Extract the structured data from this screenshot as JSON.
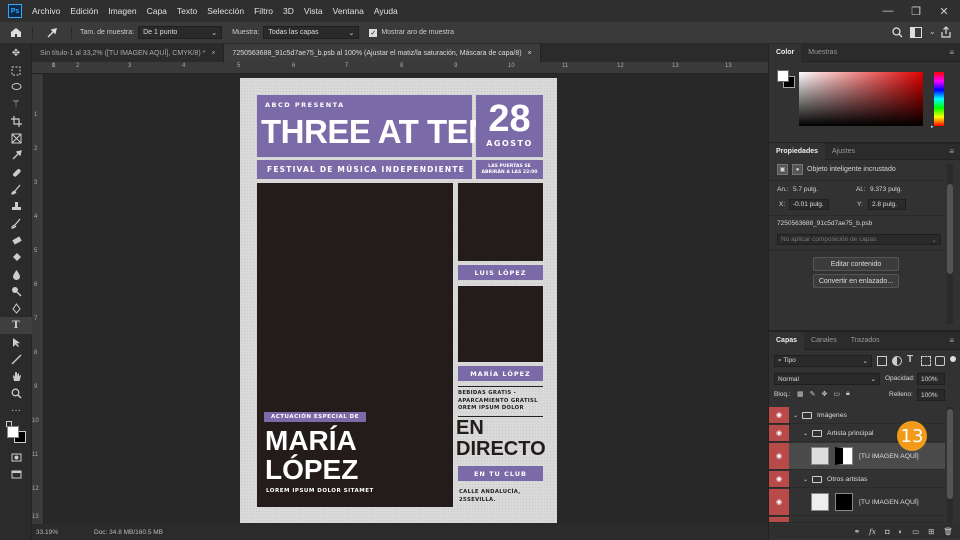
{
  "app": {
    "logo": "Ps",
    "menu": [
      "Archivo",
      "Edición",
      "Imagen",
      "Capa",
      "Texto",
      "Selección",
      "Filtro",
      "3D",
      "Vista",
      "Ventana",
      "Ayuda"
    ],
    "window_buttons": [
      "—",
      "❐",
      "✕"
    ]
  },
  "options": {
    "sample_size_label": "Tam. de muestra:",
    "sample_size_value": "De 1 punto",
    "sample_label": "Muestra:",
    "sample_value": "Todas las capas",
    "show_ring_label": "Mostrar aro de muestra"
  },
  "tabs": [
    {
      "label": "Sin título-1 al 33,2% ([TU IMAGEN AQUÍ], CMYK/8) *",
      "close": "×"
    },
    {
      "label": "7250563688_91c5d7ae75_b.psb al 100% (Ajustar el matiz/la saturación, Máscara de capa/8)",
      "close": "×"
    }
  ],
  "ruler": {
    "h": [
      "0",
      "1",
      "2",
      "3",
      "4",
      "5",
      "6",
      "7",
      "8",
      "9",
      "10",
      "11",
      "12",
      "13"
    ],
    "v": [
      "1",
      "2",
      "3",
      "4",
      "5",
      "6",
      "7",
      "8",
      "9",
      "10",
      "11",
      "12",
      "13"
    ]
  },
  "status": {
    "zoom": "33.19%",
    "doc": "Doc: 34.8 MB/160.5 MB"
  },
  "poster": {
    "presenter": "ABCD PRESENTA",
    "title": "THREE AT TEN",
    "day": "28",
    "month": "AGOSTO",
    "festival": "FESTIVAL DE MÚSICA INDEPENDIENTE",
    "doors": "LAS PUERTAS SE ABRIRÁN A LAS 22:00",
    "artist1": "LUIS LÓPEZ",
    "artist2": "MARÍA LÓPEZ",
    "special": "ACTUACIÓN ESPECIAL DE",
    "headliner_first": "MARÍA",
    "headliner_last": "LÓPEZ",
    "tagline": "LOREM IPSUM DOLOR SITAMET",
    "drinks": "BEBIDAS GRATIS - APARCAMIENTO GRATISL OREM IPSUM DOLOR",
    "live1": "EN",
    "live2": "DIRECTO",
    "club": "EN TU CLUB",
    "address": "CALLE ANDALUCÍA, 25SEVILLA."
  },
  "color_panel": {
    "tabs": [
      "Color",
      "Muestras"
    ]
  },
  "properties": {
    "tabs": [
      "Propiedades",
      "Ajustes"
    ],
    "object_type": "Objeto inteligente incrustado",
    "w_label": "An.:",
    "w_value": "5.7 pulg.",
    "h_label": "Al.:",
    "h_value": "9.373 pulg.",
    "x_label": "X:",
    "x_value": "-0.01 pulg.",
    "y_label": "Y:",
    "y_value": "2.8 pulg.",
    "filename": "7250563688_91c5d7ae75_b.psb",
    "comp_placeholder": "No aplicar composición de capas",
    "edit_btn": "Editar contenido",
    "convert_btn": "Convertir en enlazado..."
  },
  "layers_panel": {
    "tabs": [
      "Capas",
      "Canales",
      "Trazados"
    ],
    "filter": "Tipo",
    "blend": "Normal",
    "opacity_label": "Opacidad:",
    "opacity_value": "100%",
    "lock_label": "Bloq.:",
    "fill_label": "Relleno:",
    "fill_value": "100%",
    "layers": [
      {
        "name": "Imágenes"
      },
      {
        "name": "Artista principal"
      },
      {
        "name": "[TU IMAGEN AQUÍ]"
      },
      {
        "name": "Otros artistas"
      },
      {
        "name": "[TU IMAGEN AQUÍ]"
      }
    ],
    "step_badge": "13"
  },
  "colors": {
    "accent": "#7b6aa8",
    "photo": "#231c1b",
    "eye": "#b84a4a",
    "badge": "#f29a1a"
  }
}
